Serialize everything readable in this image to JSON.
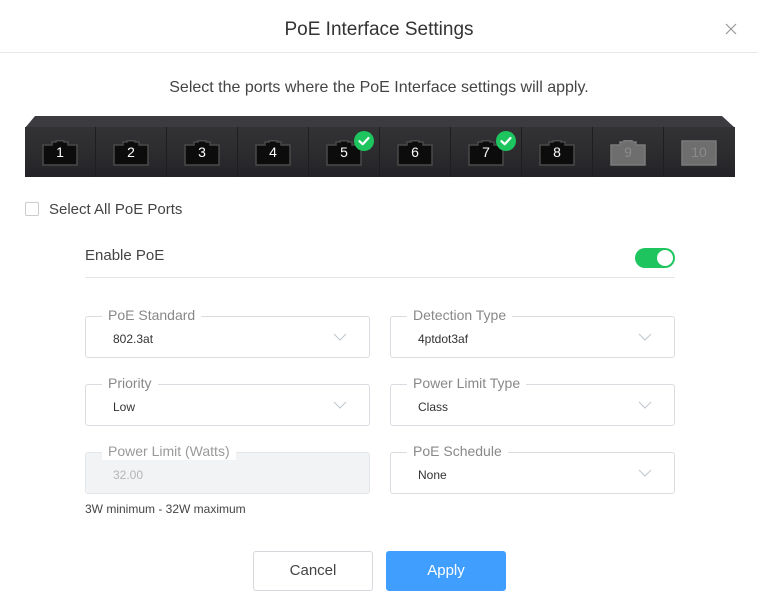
{
  "dialog": {
    "title": "PoE Interface Settings",
    "close_icon": "close-icon"
  },
  "instructions": "Select the ports where the PoE Interface settings will apply.",
  "ports": [
    {
      "number": "1",
      "selected": false,
      "disabled": false,
      "type": "rj45"
    },
    {
      "number": "2",
      "selected": false,
      "disabled": false,
      "type": "rj45"
    },
    {
      "number": "3",
      "selected": false,
      "disabled": false,
      "type": "rj45"
    },
    {
      "number": "4",
      "selected": false,
      "disabled": false,
      "type": "rj45"
    },
    {
      "number": "5",
      "selected": true,
      "disabled": false,
      "type": "rj45"
    },
    {
      "number": "6",
      "selected": false,
      "disabled": false,
      "type": "rj45"
    },
    {
      "number": "7",
      "selected": true,
      "disabled": false,
      "type": "rj45"
    },
    {
      "number": "8",
      "selected": false,
      "disabled": false,
      "type": "rj45"
    },
    {
      "number": "9",
      "selected": false,
      "disabled": true,
      "type": "rj45"
    },
    {
      "number": "10",
      "selected": false,
      "disabled": true,
      "type": "sfp"
    }
  ],
  "select_all": {
    "label": "Select All PoE Ports",
    "checked": false
  },
  "enable_poe": {
    "label": "Enable PoE",
    "on": true
  },
  "fields": {
    "poe_standard": {
      "label": "PoE Standard",
      "value": "802.3at"
    },
    "detection_type": {
      "label": "Detection Type",
      "value": "4ptdot3af"
    },
    "priority": {
      "label": "Priority",
      "value": "Low"
    },
    "power_limit_type": {
      "label": "Power Limit Type",
      "value": "Class"
    },
    "power_limit_watts": {
      "label": "Power Limit (Watts)",
      "value": "32.00",
      "disabled": true
    },
    "poe_schedule": {
      "label": "PoE Schedule",
      "value": "None"
    }
  },
  "power_limit_hint": "3W minimum - 32W maximum",
  "buttons": {
    "cancel": "Cancel",
    "apply": "Apply"
  },
  "colors": {
    "accent": "#409eff",
    "success": "#1ec55e",
    "switch_body": "#2b2a2d"
  }
}
